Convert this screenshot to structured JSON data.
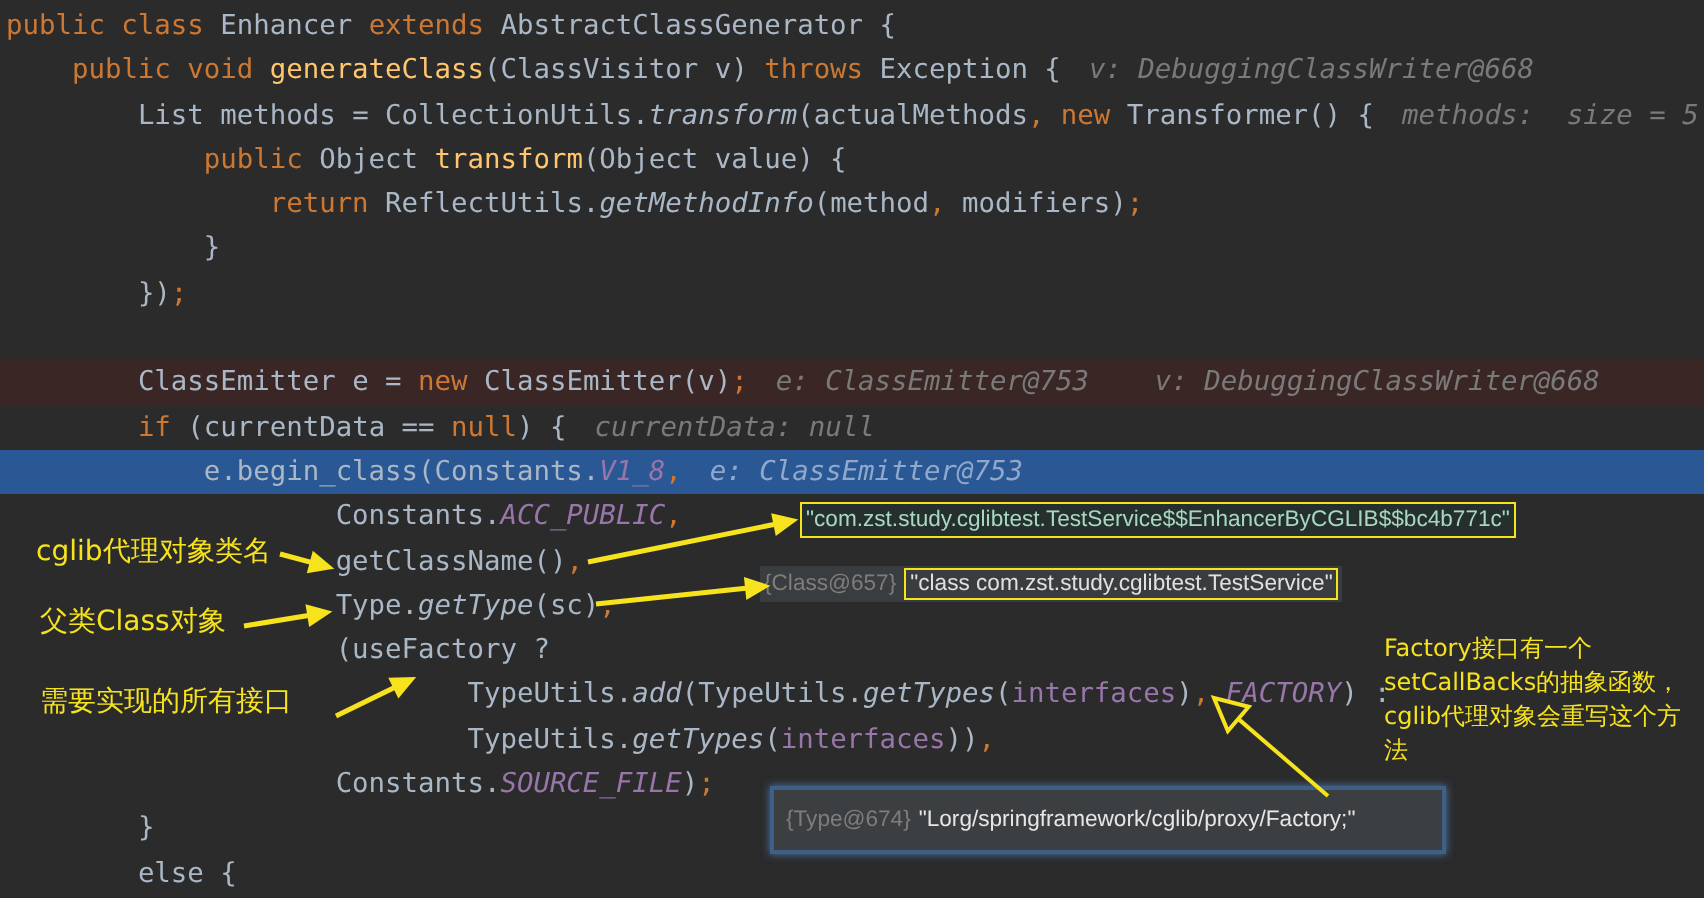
{
  "editor": {
    "lines": [
      {
        "breakpoint": false,
        "current": false,
        "tokens": [
          {
            "kind": "kw",
            "text": "public class "
          },
          {
            "kind": "plain",
            "text": "Enhancer "
          },
          {
            "kind": "kw",
            "text": "extends "
          },
          {
            "kind": "plain",
            "text": "AbstractClassGenerator {"
          }
        ]
      },
      {
        "breakpoint": false,
        "current": false,
        "tokens": [
          {
            "kind": "kw",
            "text": "    public void "
          },
          {
            "kind": "decl",
            "text": "generateClass"
          },
          {
            "kind": "plain",
            "text": "(ClassVisitor v) "
          },
          {
            "kind": "kw",
            "text": "throws "
          },
          {
            "kind": "plain",
            "text": "Exception {"
          },
          {
            "kind": "hint",
            "text": "v: DebuggingClassWriter@668"
          }
        ]
      },
      {
        "breakpoint": false,
        "current": false,
        "tokens": [
          {
            "kind": "plain",
            "text": "        List methods = CollectionUtils."
          },
          {
            "kind": "call",
            "text": "transform"
          },
          {
            "kind": "plain",
            "text": "(actualMethods"
          },
          {
            "kind": "kw",
            "text": ", new "
          },
          {
            "kind": "plain",
            "text": "Transformer() {"
          },
          {
            "kind": "hint",
            "text": "methods:  size = 5"
          }
        ]
      },
      {
        "breakpoint": false,
        "current": false,
        "tokens": [
          {
            "kind": "kw",
            "text": "            public "
          },
          {
            "kind": "plain",
            "text": "Object "
          },
          {
            "kind": "decl",
            "text": "transform"
          },
          {
            "kind": "plain",
            "text": "(Object value) {"
          }
        ]
      },
      {
        "breakpoint": false,
        "current": false,
        "tokens": [
          {
            "kind": "kw",
            "text": "                return "
          },
          {
            "kind": "plain",
            "text": "ReflectUtils."
          },
          {
            "kind": "call",
            "text": "getMethodInfo"
          },
          {
            "kind": "plain",
            "text": "(method"
          },
          {
            "kind": "kw",
            "text": ", "
          },
          {
            "kind": "plain",
            "text": "modifiers)"
          },
          {
            "kind": "kw",
            "text": ";"
          }
        ]
      },
      {
        "breakpoint": false,
        "current": false,
        "tokens": [
          {
            "kind": "plain",
            "text": "            }"
          }
        ]
      },
      {
        "breakpoint": false,
        "current": false,
        "tokens": [
          {
            "kind": "plain",
            "text": "        })"
          },
          {
            "kind": "kw",
            "text": ";"
          }
        ]
      },
      {
        "breakpoint": false,
        "current": false
      },
      {
        "breakpoint": true,
        "current": false,
        "tokens": [
          {
            "kind": "plain",
            "text": "        ClassEmitter e = "
          },
          {
            "kind": "kw",
            "text": "new "
          },
          {
            "kind": "plain",
            "text": "ClassEmitter(v)"
          },
          {
            "kind": "kw",
            "text": ";"
          },
          {
            "kind": "hint",
            "text": "e: ClassEmitter@753    v: DebuggingClassWriter@668"
          }
        ]
      },
      {
        "breakpoint": false,
        "current": false,
        "tokens": [
          {
            "kind": "kw",
            "text": "        if "
          },
          {
            "kind": "plain",
            "text": "(currentData == "
          },
          {
            "kind": "kw",
            "text": "null"
          },
          {
            "kind": "plain",
            "text": ") {"
          },
          {
            "kind": "hint",
            "text": "currentData: null"
          }
        ]
      },
      {
        "breakpoint": false,
        "current": true,
        "tokens": [
          {
            "kind": "plain",
            "text": "            e.begin_class(Constants."
          },
          {
            "kind": "const",
            "text": "V1_8"
          },
          {
            "kind": "kw",
            "text": ","
          },
          {
            "kind": "hint",
            "text": "e: ClassEmitter@753"
          }
        ]
      },
      {
        "breakpoint": false,
        "current": false,
        "tokens": [
          {
            "kind": "plain",
            "text": "                    Constants."
          },
          {
            "kind": "const",
            "text": "ACC_PUBLIC"
          },
          {
            "kind": "kw",
            "text": ","
          }
        ]
      },
      {
        "breakpoint": false,
        "current": false,
        "tokens": [
          {
            "kind": "plain",
            "text": "                    getClassName()"
          },
          {
            "kind": "kw",
            "text": ","
          }
        ]
      },
      {
        "breakpoint": false,
        "current": false,
        "tokens": [
          {
            "kind": "plain",
            "text": "                    Type."
          },
          {
            "kind": "call",
            "text": "getType"
          },
          {
            "kind": "plain",
            "text": "(sc)"
          },
          {
            "kind": "kw",
            "text": ","
          }
        ]
      },
      {
        "breakpoint": false,
        "current": false,
        "tokens": [
          {
            "kind": "plain",
            "text": "                    (useFactory ?"
          }
        ]
      },
      {
        "breakpoint": false,
        "current": false,
        "tokens": [
          {
            "kind": "plain",
            "text": "                            TypeUtils."
          },
          {
            "kind": "call",
            "text": "add"
          },
          {
            "kind": "plain",
            "text": "(TypeUtils."
          },
          {
            "kind": "call",
            "text": "getTypes"
          },
          {
            "kind": "plain",
            "text": "("
          },
          {
            "kind": "field",
            "text": "interfaces"
          },
          {
            "kind": "plain",
            "text": ")"
          },
          {
            "kind": "kw",
            "text": ", "
          },
          {
            "kind": "const",
            "text": "FACTORY"
          },
          {
            "kind": "plain",
            "text": ") :"
          }
        ]
      },
      {
        "breakpoint": false,
        "current": false,
        "tokens": [
          {
            "kind": "plain",
            "text": "                            TypeUtils."
          },
          {
            "kind": "call",
            "text": "getTypes"
          },
          {
            "kind": "plain",
            "text": "("
          },
          {
            "kind": "field",
            "text": "interfaces"
          },
          {
            "kind": "plain",
            "text": "))"
          },
          {
            "kind": "kw",
            "text": ","
          }
        ]
      },
      {
        "breakpoint": false,
        "current": false,
        "tokens": [
          {
            "kind": "plain",
            "text": "                    Constants."
          },
          {
            "kind": "const",
            "text": "SOURCE_FILE"
          },
          {
            "kind": "plain",
            "text": ")"
          },
          {
            "kind": "kw",
            "text": ";"
          }
        ]
      },
      {
        "breakpoint": false,
        "current": false,
        "tokens": [
          {
            "kind": "plain",
            "text": "        }"
          }
        ]
      },
      {
        "breakpoint": false,
        "current": false,
        "tokens": [
          {
            "kind": "plain",
            "text": "        else {"
          }
        ]
      }
    ]
  },
  "annotations": {
    "labels": [
      "cglib代理对象类名",
      "父类Class对象",
      "需要实现的所有接口"
    ],
    "note": "Factory接口有一个setCallBacks的抽象函数，cglib代理对象会重写这个方法",
    "class_name_value": "\"com.zst.study.cglibtest.TestService$$EnhancerByCGLIB$$bc4b771c\"",
    "superclass_value": {
      "type": "{Class@657}",
      "value": "\"class com.zst.study.cglibtest.TestService\""
    },
    "factory_popup": {
      "type": "{Type@674}",
      "value": "\"Lorg/springframework/cglib/proxy/Factory;\""
    }
  }
}
